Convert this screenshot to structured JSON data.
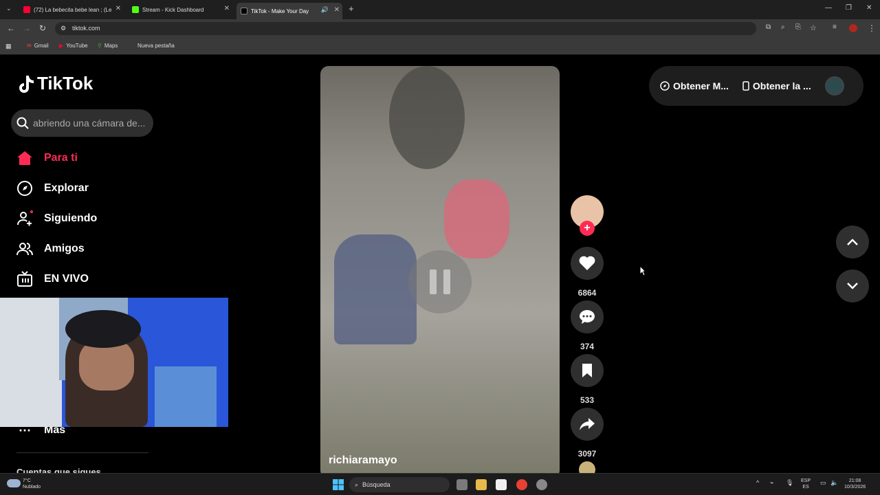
{
  "browser": {
    "tabs": [
      {
        "title": "(72) La bebecita bebe lean ; (Le",
        "color": "#ff0033"
      },
      {
        "title": "Stream - Kick Dashboard",
        "color": "#53fc18"
      },
      {
        "title": "TikTok - Make Your Day",
        "color": "#000000"
      }
    ],
    "url": "tiktok.com",
    "bookmarks": [
      {
        "label": "Gmail"
      },
      {
        "label": "YouTube"
      },
      {
        "label": "Maps"
      },
      {
        "label": "Nueva pestaña"
      }
    ]
  },
  "sidebar": {
    "logo": "TikTok",
    "search_placeholder": "abriendo una cámara de...",
    "nav": [
      {
        "label": "Para ti",
        "icon": "home-icon"
      },
      {
        "label": "Explorar",
        "icon": "compass-icon"
      },
      {
        "label": "Siguiendo",
        "icon": "following-icon"
      },
      {
        "label": "Amigos",
        "icon": "friends-icon"
      },
      {
        "label": "EN VIVO",
        "icon": "live-icon"
      },
      {
        "label": "Más",
        "icon": "more-icon"
      }
    ],
    "following_header": "Cuentas que sigues"
  },
  "video": {
    "username": "richiaramayo"
  },
  "actions": {
    "likes": "6864",
    "comments": "374",
    "saves": "533",
    "shares": "3097"
  },
  "topright": {
    "item1": "Obtener M...",
    "item2": "Obtener la ..."
  },
  "taskbar": {
    "weather_temp": "7°C",
    "weather_desc": "Nublado",
    "search": "Búsqueda",
    "lang1": "ESP",
    "lang2": "ES",
    "time": "21:08",
    "date": "10/3/2026"
  }
}
